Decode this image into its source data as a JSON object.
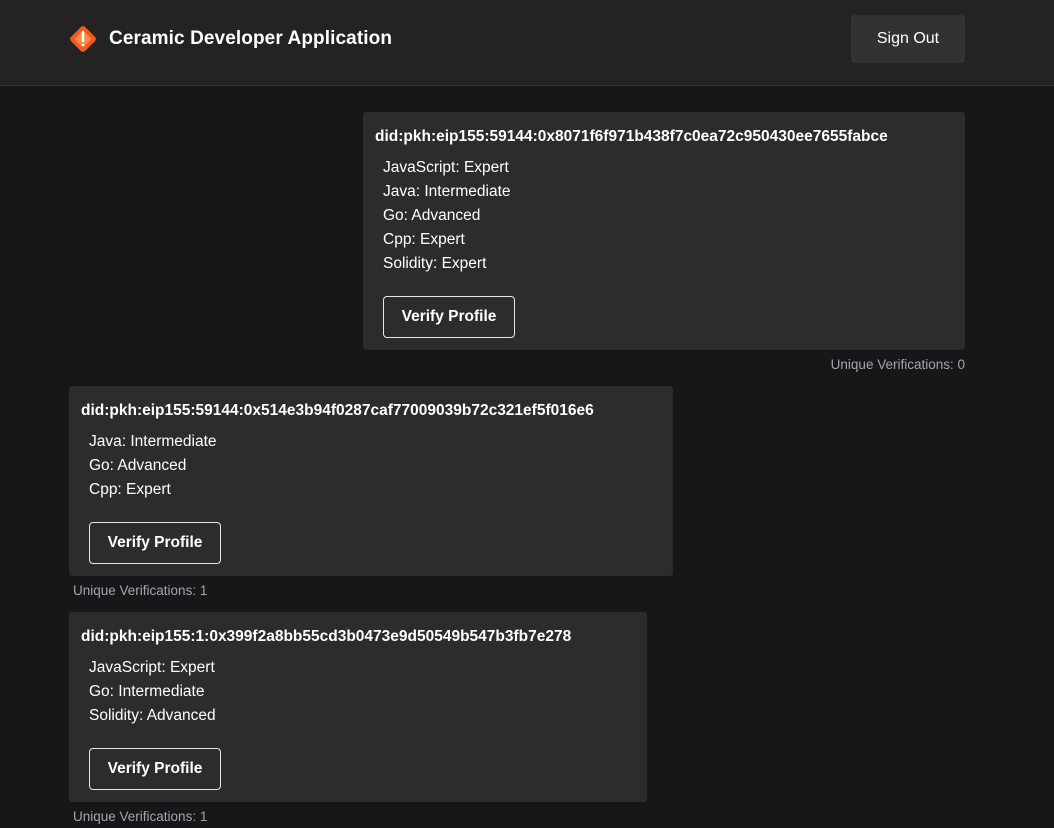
{
  "header": {
    "logo_icon": "ceramic-logo-icon",
    "title": "Ceramic Developer Application",
    "sign_out_label": "Sign Out"
  },
  "colors": {
    "background": "#17171a",
    "header": "#232325",
    "card": "#2c2c2f",
    "logo_accent": "#f25a1e",
    "muted_text": "#a5a5aa"
  },
  "profiles": [
    {
      "did": "did:pkh:eip155:59144:0x8071f6f971b438f7c0ea72c950430ee7655fabce",
      "skills": [
        "JavaScript: Expert",
        "Java: Intermediate",
        "Go: Advanced",
        "Cpp: Expert",
        "Solidity: Expert"
      ],
      "verify_label": "Verify Profile",
      "verifications": "Unique Verifications: 0"
    },
    {
      "did": "did:pkh:eip155:59144:0x514e3b94f0287caf77009039b72c321ef5f016e6",
      "skills": [
        "Java: Intermediate",
        "Go: Advanced",
        "Cpp: Expert"
      ],
      "verify_label": "Verify Profile",
      "verifications": "Unique Verifications: 1"
    },
    {
      "did": "did:pkh:eip155:1:0x399f2a8bb55cd3b0473e9d50549b547b3fb7e278",
      "skills": [
        "JavaScript: Expert",
        "Go: Intermediate",
        "Solidity: Advanced"
      ],
      "verify_label": "Verify Profile",
      "verifications": "Unique Verifications: 1"
    }
  ]
}
